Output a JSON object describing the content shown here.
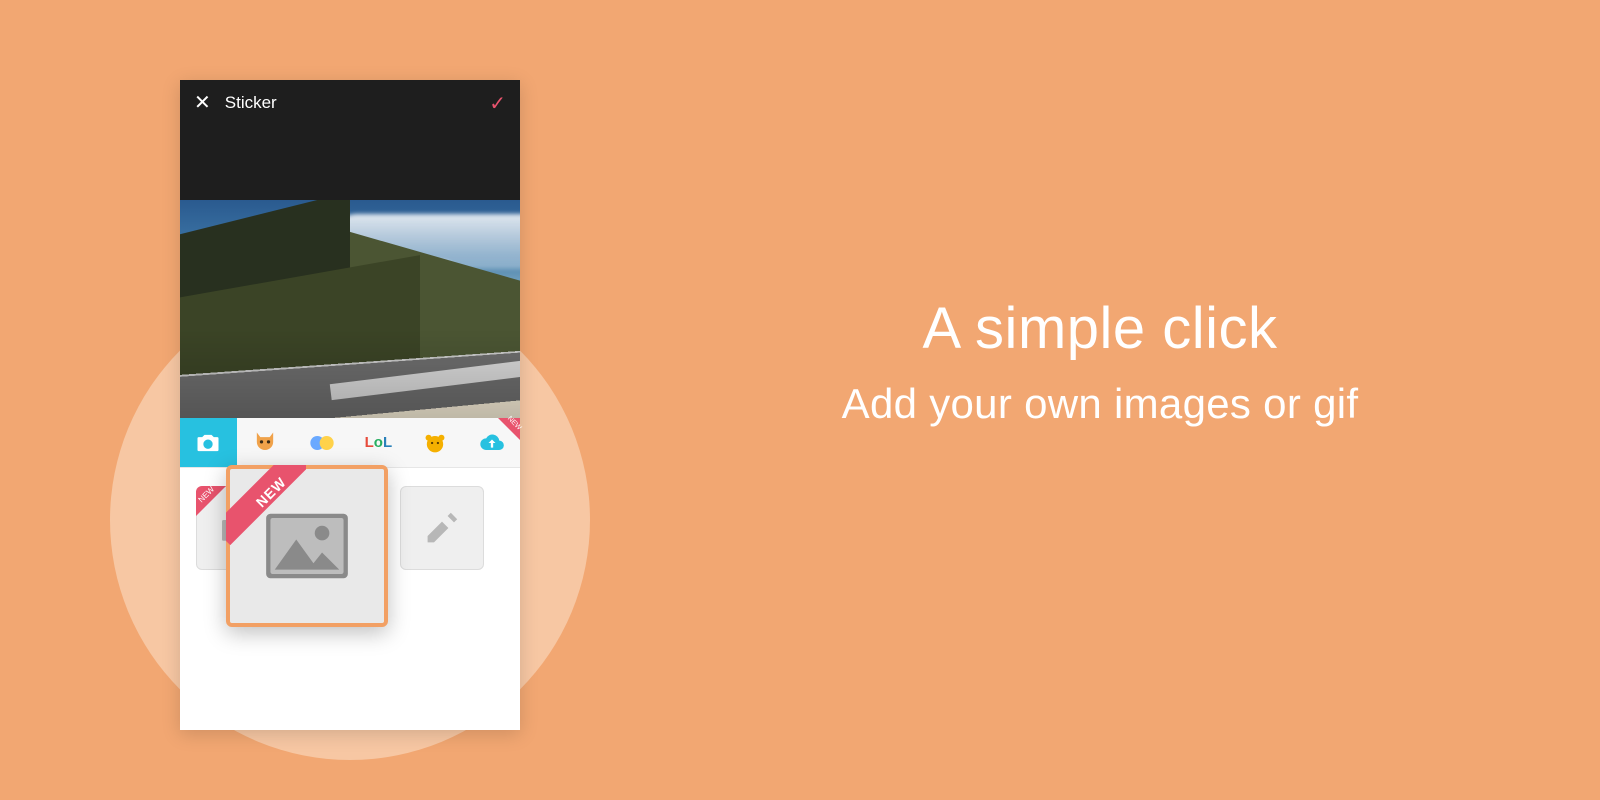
{
  "background_color": "#f2a772",
  "spotlight_color": "#f7c7a3",
  "accent_color": "#e8536d",
  "highlight_border_color": "#f2a064",
  "copy": {
    "headline": "A simple click",
    "subline": "Add your own images or gif"
  },
  "phone": {
    "topbar": {
      "close_icon": "close-icon",
      "title": "Sticker",
      "confirm_icon": "check-icon"
    },
    "categories": [
      {
        "name": "camera",
        "selected": true,
        "new": false
      },
      {
        "name": "cat",
        "selected": false,
        "new": false
      },
      {
        "name": "sticker",
        "selected": false,
        "new": false
      },
      {
        "name": "lol",
        "selected": false,
        "new": false,
        "label": "LoL"
      },
      {
        "name": "bear",
        "selected": false,
        "new": false
      },
      {
        "name": "cloud",
        "selected": false,
        "new": true
      }
    ],
    "tiles": [
      {
        "type": "add-photo",
        "new": true
      },
      {
        "type": "add-gif",
        "new": false
      }
    ],
    "popout": {
      "ribbon_label": "NEW",
      "icon": "image-placeholder-icon"
    }
  }
}
